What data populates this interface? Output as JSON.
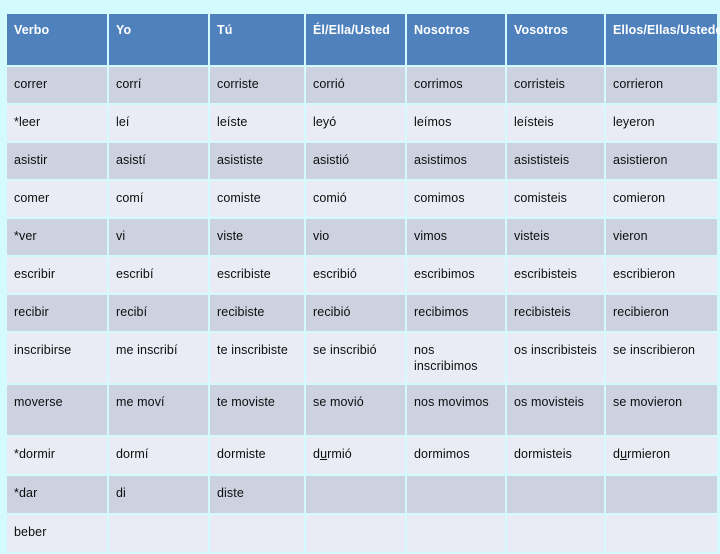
{
  "table": {
    "name": "preterite-conjugation-table",
    "colors": {
      "page_background": "#d3fbfd",
      "header_background": "#4f81bd",
      "header_text": "#ffffff",
      "row_dark": "#ccd2e0",
      "row_light": "#e9ecf4",
      "cell_text": "#0d0d0d"
    },
    "headers": [
      "Verbo",
      "Yo",
      "Tú",
      "Él/Ella/Usted",
      "Nosotros",
      "Vosotros",
      "Ellos/Ellas/Ustedes"
    ],
    "rows": [
      {
        "verb": "correr",
        "cells": [
          "correr",
          "corrí",
          "corriste",
          "corrió",
          "corrimos",
          "corristeis",
          "corrieron"
        ]
      },
      {
        "verb": "*leer",
        "cells": [
          "*leer",
          "leí",
          "leíste",
          "leyó",
          "leímos",
          "leísteis",
          "leyeron"
        ]
      },
      {
        "verb": "asistir",
        "cells": [
          "asistir",
          "asistí",
          "asististe",
          "asistió",
          "asistimos",
          "asististeis",
          "asistieron"
        ]
      },
      {
        "verb": "comer",
        "cells": [
          "comer",
          "comí",
          "comiste",
          "comió",
          "comimos",
          "comisteis",
          "comieron"
        ]
      },
      {
        "verb": "*ver",
        "cells": [
          "*ver",
          "vi",
          "viste",
          "vio",
          "vimos",
          "visteis",
          "vieron"
        ]
      },
      {
        "verb": "escribir",
        "cells": [
          "escribir",
          "escribí",
          "escribiste",
          "escribió",
          "escribimos",
          "escribisteis",
          "escribieron"
        ]
      },
      {
        "verb": "recibir",
        "cells": [
          "recibir",
          "recibí",
          "recibiste",
          "recibió",
          "recibimos",
          "recibisteis",
          "recibieron"
        ]
      },
      {
        "verb": "inscribirse",
        "cells": [
          "inscribirse",
          "me inscribí",
          "te inscribiste",
          "se inscribió",
          "nos inscribimos",
          "os inscribisteis",
          "se inscribieron"
        ]
      },
      {
        "verb": "moverse",
        "cells": [
          "moverse",
          "me moví",
          "te moviste",
          "se movió",
          "nos movimos",
          "os movisteis",
          "se movieron"
        ]
      },
      {
        "verb": "*dormir",
        "cells": [
          "*dormir",
          "dormí",
          "dormiste",
          "durmió",
          "dormimos",
          "dormisteis",
          "durmieron"
        ],
        "underlined": [
          3,
          6
        ]
      },
      {
        "verb": "*dar",
        "cells": [
          "*dar",
          "di",
          "diste",
          "",
          "",
          "",
          ""
        ]
      },
      {
        "verb": "beber",
        "cells": [
          "beber",
          "",
          "",
          "",
          "",
          "",
          ""
        ]
      }
    ]
  }
}
